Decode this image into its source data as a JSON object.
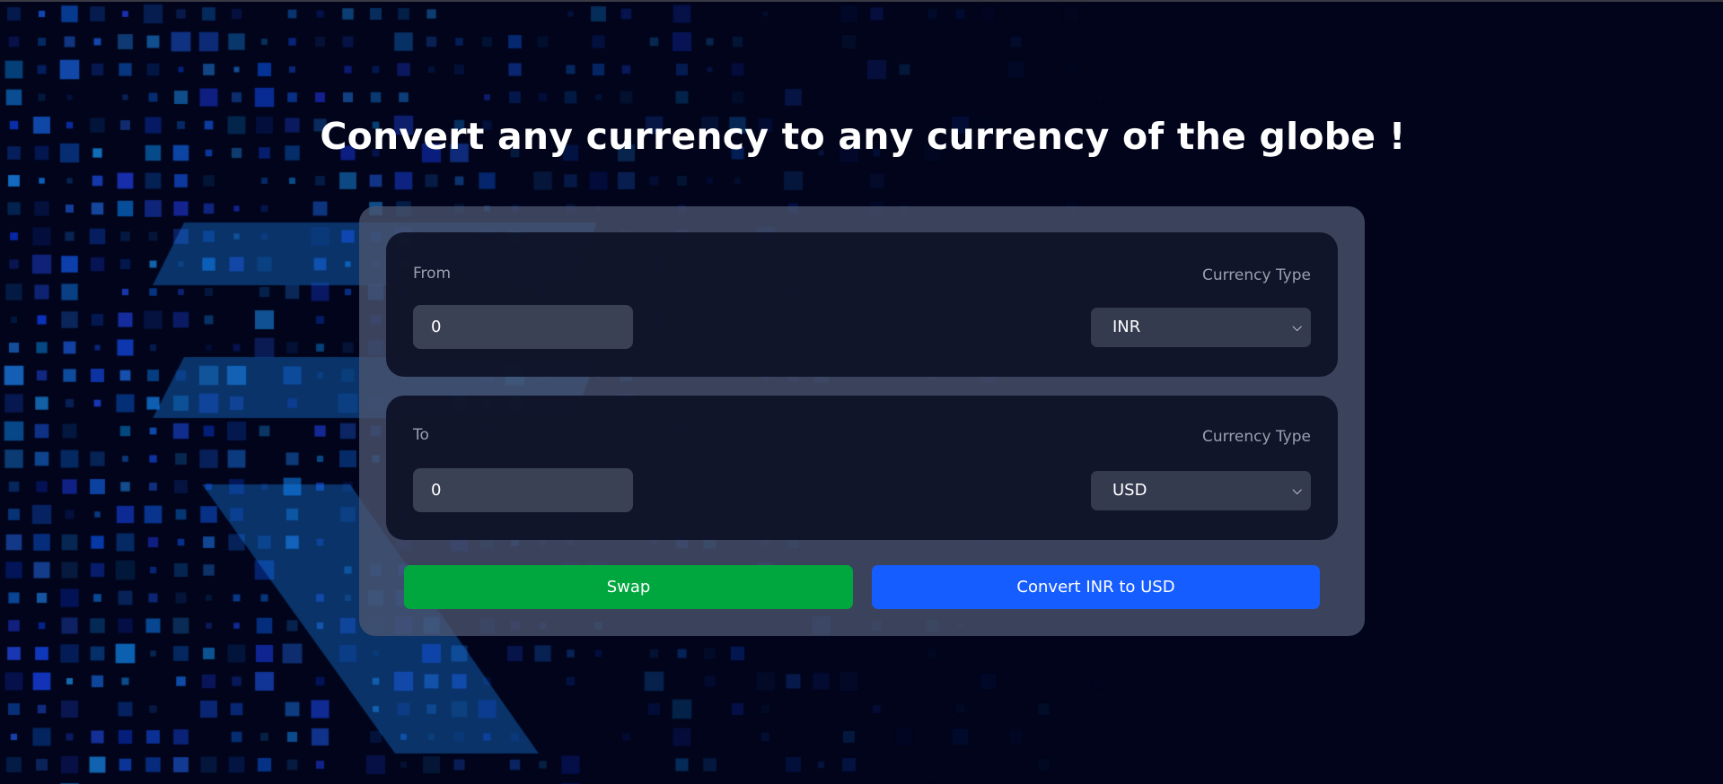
{
  "title": "Convert any currency to any currency of the globe !",
  "from": {
    "label": "From",
    "currency_label": "Currency Type",
    "amount": "0",
    "currency": "INR"
  },
  "to": {
    "label": "To",
    "currency_label": "Currency Type",
    "amount": "0",
    "currency": "USD"
  },
  "buttons": {
    "swap": "Swap",
    "convert": "Convert INR to USD"
  },
  "colors": {
    "swap": "#00a63e",
    "convert": "#165dff",
    "background": "#01041a"
  },
  "icons": {
    "select": "chevron-down-icon",
    "background": "rupee-pixel-pattern"
  }
}
